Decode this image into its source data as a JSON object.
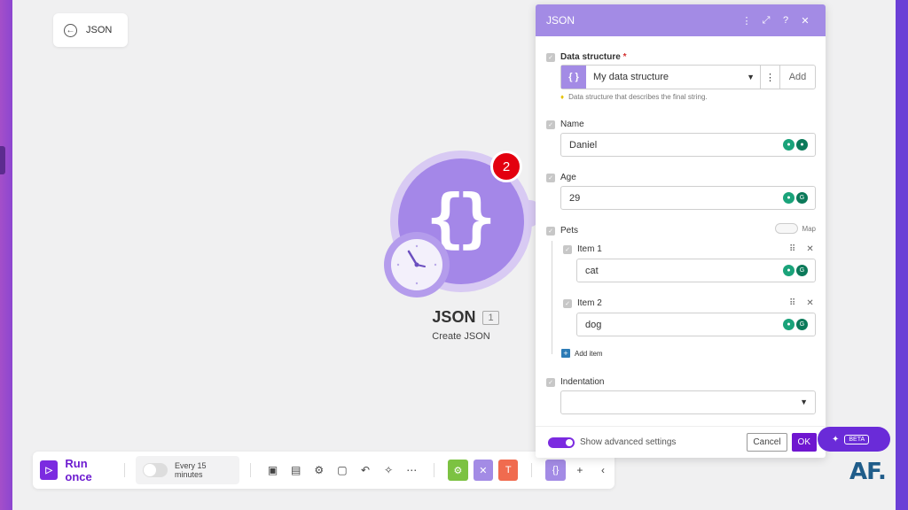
{
  "back_chip": {
    "label": "JSON"
  },
  "module": {
    "title": "JSON",
    "number": "1",
    "subtitle": "Create JSON",
    "badge": "2",
    "icon": "braces-icon"
  },
  "toolbar": {
    "run_label": "Run once",
    "schedule_label": "Every 15 minutes",
    "icons": [
      "save-icon",
      "layout-icon",
      "settings-icon",
      "note-icon",
      "undo-icon",
      "magic-wand-icon",
      "more-icon"
    ],
    "colored_buttons": [
      {
        "name": "tools-button",
        "color": "#7cc242",
        "glyph": "⚙"
      },
      {
        "name": "flow-control-button",
        "color": "#a38be5",
        "glyph": "✕"
      },
      {
        "name": "text-parser-button",
        "color": "#f06b4f",
        "glyph": "T"
      },
      {
        "name": "json-module-button",
        "color": "#a38be5",
        "glyph": "{ }"
      }
    ]
  },
  "panel": {
    "title": "JSON",
    "data_structure": {
      "label": "Data structure",
      "required": "*",
      "value": "My data structure",
      "add_label": "Add",
      "hint": "Data structure that describes the final string."
    },
    "name": {
      "label": "Name",
      "value": "Daniel"
    },
    "age": {
      "label": "Age",
      "value": "29"
    },
    "pets": {
      "label": "Pets",
      "map_label": "Map",
      "items": [
        {
          "label": "Item 1",
          "value": "cat"
        },
        {
          "label": "Item 2",
          "value": "dog"
        }
      ],
      "add_item_label": "Add item"
    },
    "indentation": {
      "label": "Indentation",
      "value": ""
    },
    "footer": {
      "advanced_label": "Show advanced settings",
      "cancel_label": "Cancel",
      "ok_label": "OK"
    }
  },
  "ai_pill": {
    "beta_label": "BETA"
  },
  "watermark": "AF.",
  "colors": {
    "accent": "#6f16d0",
    "module_purple": "#a487e8",
    "panel_header": "#a38be5",
    "badge_red": "#e3000f"
  }
}
